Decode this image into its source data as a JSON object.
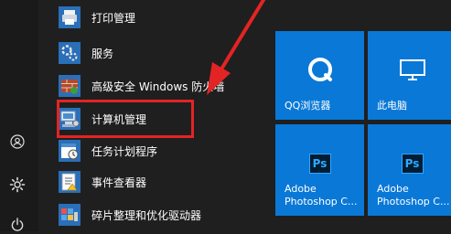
{
  "start_menu": {
    "apps": [
      {
        "label": "打印管理",
        "icon": "printer-icon"
      },
      {
        "label": "服务",
        "icon": "services-gear-icon"
      },
      {
        "label": "高级安全 Windows 防火墙",
        "icon": "firewall-icon"
      },
      {
        "label": "计算机管理",
        "icon": "computer-management-icon"
      },
      {
        "label": "任务计划程序",
        "icon": "task-scheduler-icon"
      },
      {
        "label": "事件查看器",
        "icon": "event-viewer-icon"
      },
      {
        "label": "碎片整理和优化驱动器",
        "icon": "defragment-icon"
      }
    ],
    "rail": {
      "user_icon": "user-icon",
      "settings_icon": "gear-icon",
      "power_icon": "power-icon"
    },
    "tiles": [
      {
        "label": "QQ浏览器",
        "icon": "qq-browser-icon",
        "icon_text": ""
      },
      {
        "label": "此电脑",
        "icon": "computer-icon",
        "icon_text": ""
      },
      {
        "label_line1": "Adobe",
        "label_line2": "Photoshop C...",
        "icon": "photoshop-icon",
        "icon_text": "Ps"
      },
      {
        "label_line1": "Adobe",
        "label_line2": "Photoshop C...",
        "icon": "photoshop-icon",
        "icon_text": "Ps"
      }
    ],
    "colors": {
      "tile_blue": "#0a78d7",
      "highlight_red": "#e32424",
      "background": "#1f1f1f"
    }
  }
}
